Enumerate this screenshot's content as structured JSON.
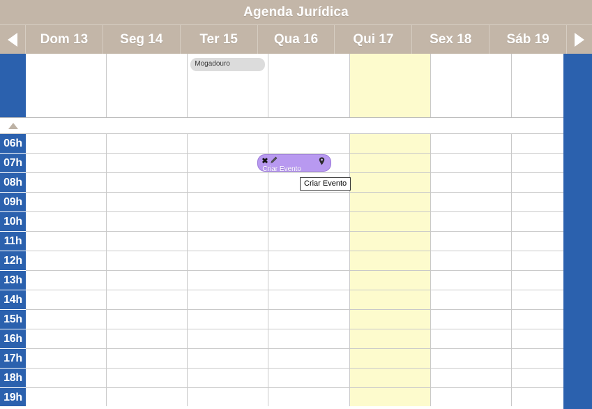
{
  "titlebar": {
    "title": "Agenda Jurídica"
  },
  "nav": {
    "prev_icon": "triangle-left-icon",
    "next_icon": "triangle-right-icon",
    "prev_label": "◀",
    "next_label": "▶"
  },
  "days": [
    {
      "label": "Dom 13",
      "today": false
    },
    {
      "label": "Seg 14",
      "today": false
    },
    {
      "label": "Ter 15",
      "today": false
    },
    {
      "label": "Qua 16",
      "today": false
    },
    {
      "label": "Qui 17",
      "today": true
    },
    {
      "label": "Sex 18",
      "today": false
    },
    {
      "label": "Sáb 19",
      "today": false
    }
  ],
  "allday_events": [
    {
      "title": "Mogadouro",
      "day_index": 2
    }
  ],
  "splitter": {
    "collapse_icon": "triangle-up-icon"
  },
  "hours": [
    "06h",
    "07h",
    "08h",
    "09h",
    "10h",
    "11h",
    "12h",
    "13h",
    "14h",
    "15h",
    "16h",
    "17h",
    "18h",
    "19h"
  ],
  "events": [
    {
      "title": "Criar Evento",
      "day_index": 3,
      "hour_index": 1,
      "delete_icon": "close-x-icon",
      "edit_icon": "pencil-icon",
      "location_icon": "map-pin-icon",
      "color": "#b899f0"
    }
  ],
  "tooltip": {
    "text": "Criar Evento"
  },
  "colors": {
    "header_bg": "#c3b6a8",
    "gutter_blue": "#2b61ae",
    "today_yellow": "#fdfbcd",
    "event_purple": "#b899f0",
    "allday_grey": "#dcdcdc"
  }
}
